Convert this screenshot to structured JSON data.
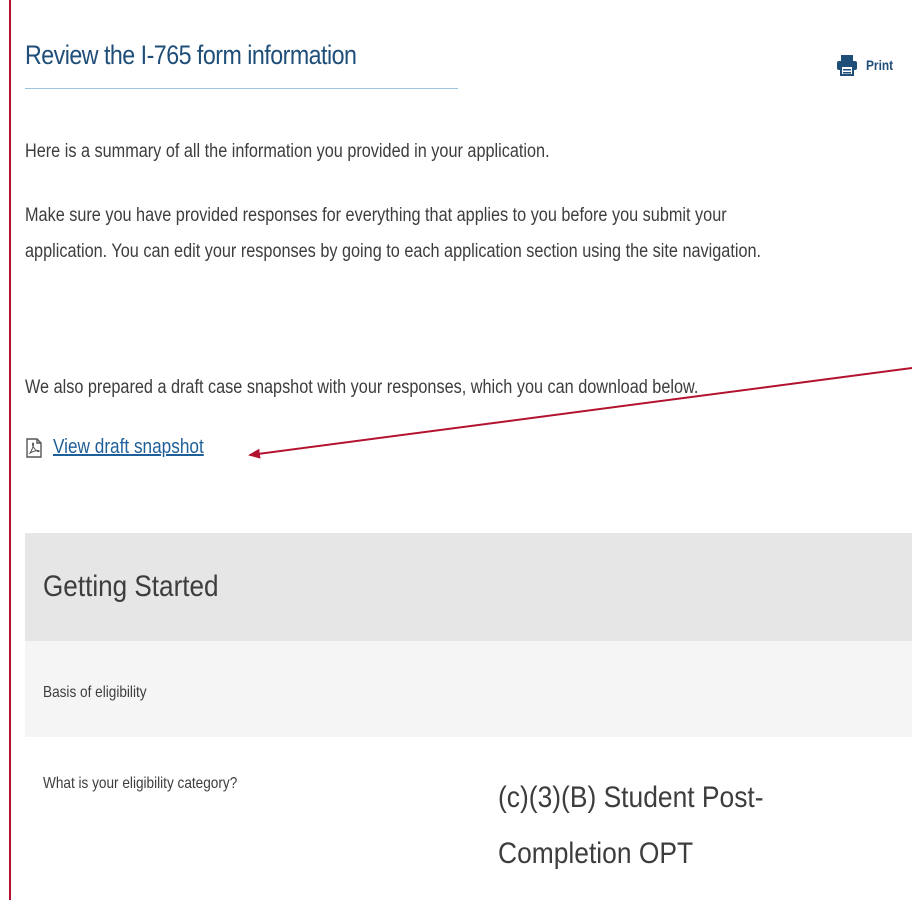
{
  "header": {
    "title": "Review the I-765 form information",
    "print_label": "Print"
  },
  "intro": {
    "paragraph_1": "Here is a summary of all the information you provided in your application.",
    "paragraph_2_line_1": "Make sure you have provided responses for everything that applies to you before you submit your",
    "paragraph_2_line_2": "application. You can edit your responses by going to each application section using the site navigation.",
    "paragraph_3": "We also prepared a draft case snapshot with your responses, which you can download below."
  },
  "snapshot": {
    "link_label": "View draft snapshot",
    "icon": "pdf-icon"
  },
  "section": {
    "title": "Getting Started",
    "subsection": "Basis of eligibility",
    "question": "What is your eligibility category?",
    "answer": "(c)(3)(B) Student Post-Completion OPT"
  },
  "colors": {
    "accent_border": "#b3122f",
    "title": "#1f4e79",
    "link": "#1f5f99",
    "annotation_arrow": "#b3122f",
    "section_header_bg": "#e6e6e6",
    "subsection_bg": "#f5f5f5"
  },
  "icons": {
    "print": "printer-icon",
    "snapshot": "pdf-icon"
  }
}
